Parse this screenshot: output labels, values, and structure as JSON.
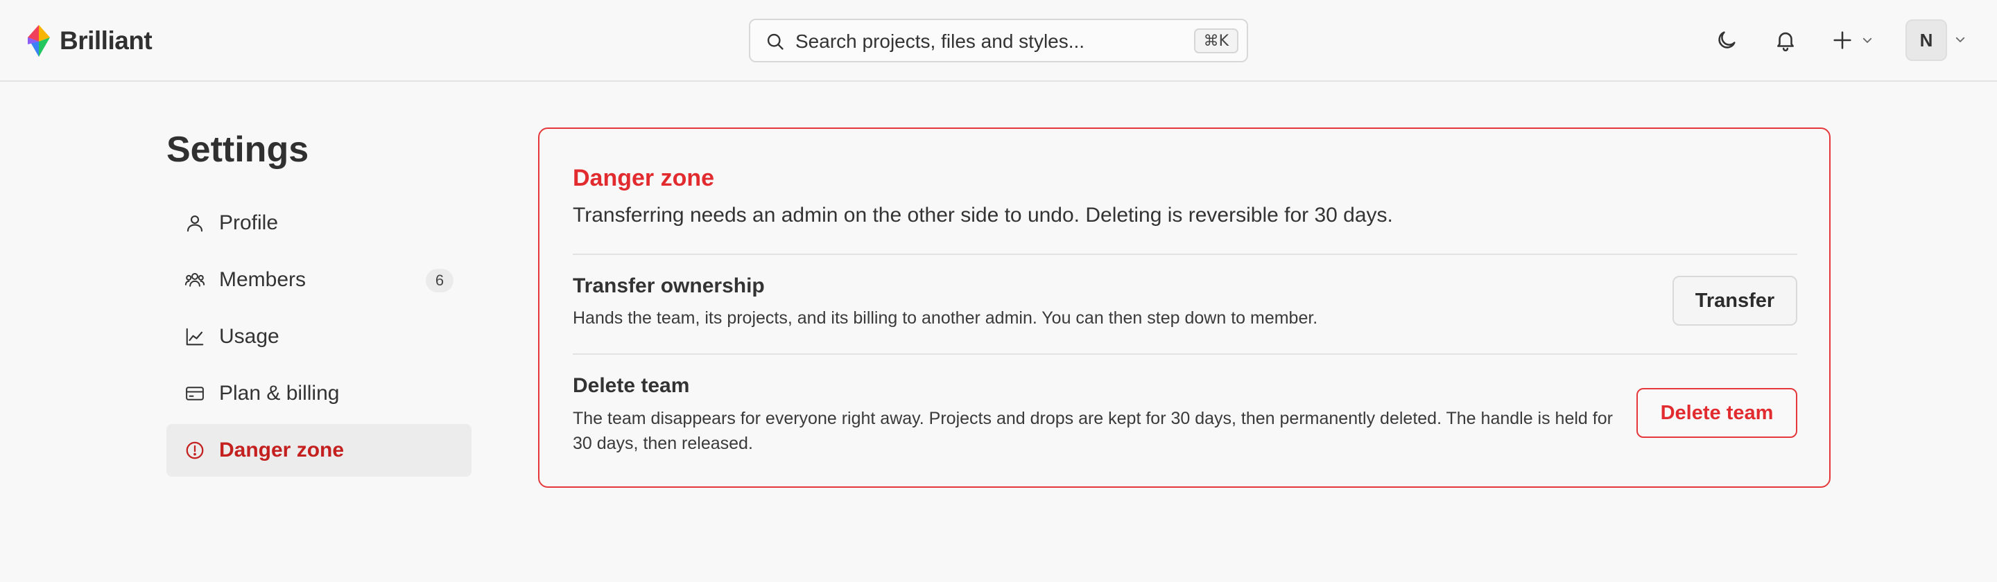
{
  "header": {
    "brand_name": "Brilliant",
    "search": {
      "placeholder": "Search projects, files and styles...",
      "shortcut": "⌘K"
    },
    "avatar_initial": "N",
    "icons": [
      "moon-icon",
      "bell-icon",
      "plus-icon",
      "chevron-down-icon"
    ]
  },
  "sidebar": {
    "title": "Settings",
    "items": [
      {
        "label": "Profile",
        "icon": "user-icon"
      },
      {
        "label": "Members",
        "icon": "users-icon",
        "badge": "6"
      },
      {
        "label": "Usage",
        "icon": "chart-icon"
      },
      {
        "label": "Plan & billing",
        "icon": "credit-card-icon"
      },
      {
        "label": "Danger zone",
        "icon": "alert-circle-icon",
        "active": true
      }
    ]
  },
  "danger_zone": {
    "title": "Danger zone",
    "description": "Transferring needs an admin on the other side to undo. Deleting is reversible for 30 days.",
    "transfer": {
      "title": "Transfer ownership",
      "description": "Hands the team, its projects, and its billing to another admin. You can then step down to member.",
      "button": "Transfer"
    },
    "delete": {
      "title": "Delete team",
      "description": "The team disappears for everyone right away. Projects and drops are kept for 30 days, then permanently deleted. The handle is held for 30 days, then released.",
      "button": "Delete team"
    }
  },
  "colors": {
    "danger": "#e12b2f",
    "active_nav_text": "#c42020",
    "background": "#f8f8f8"
  }
}
